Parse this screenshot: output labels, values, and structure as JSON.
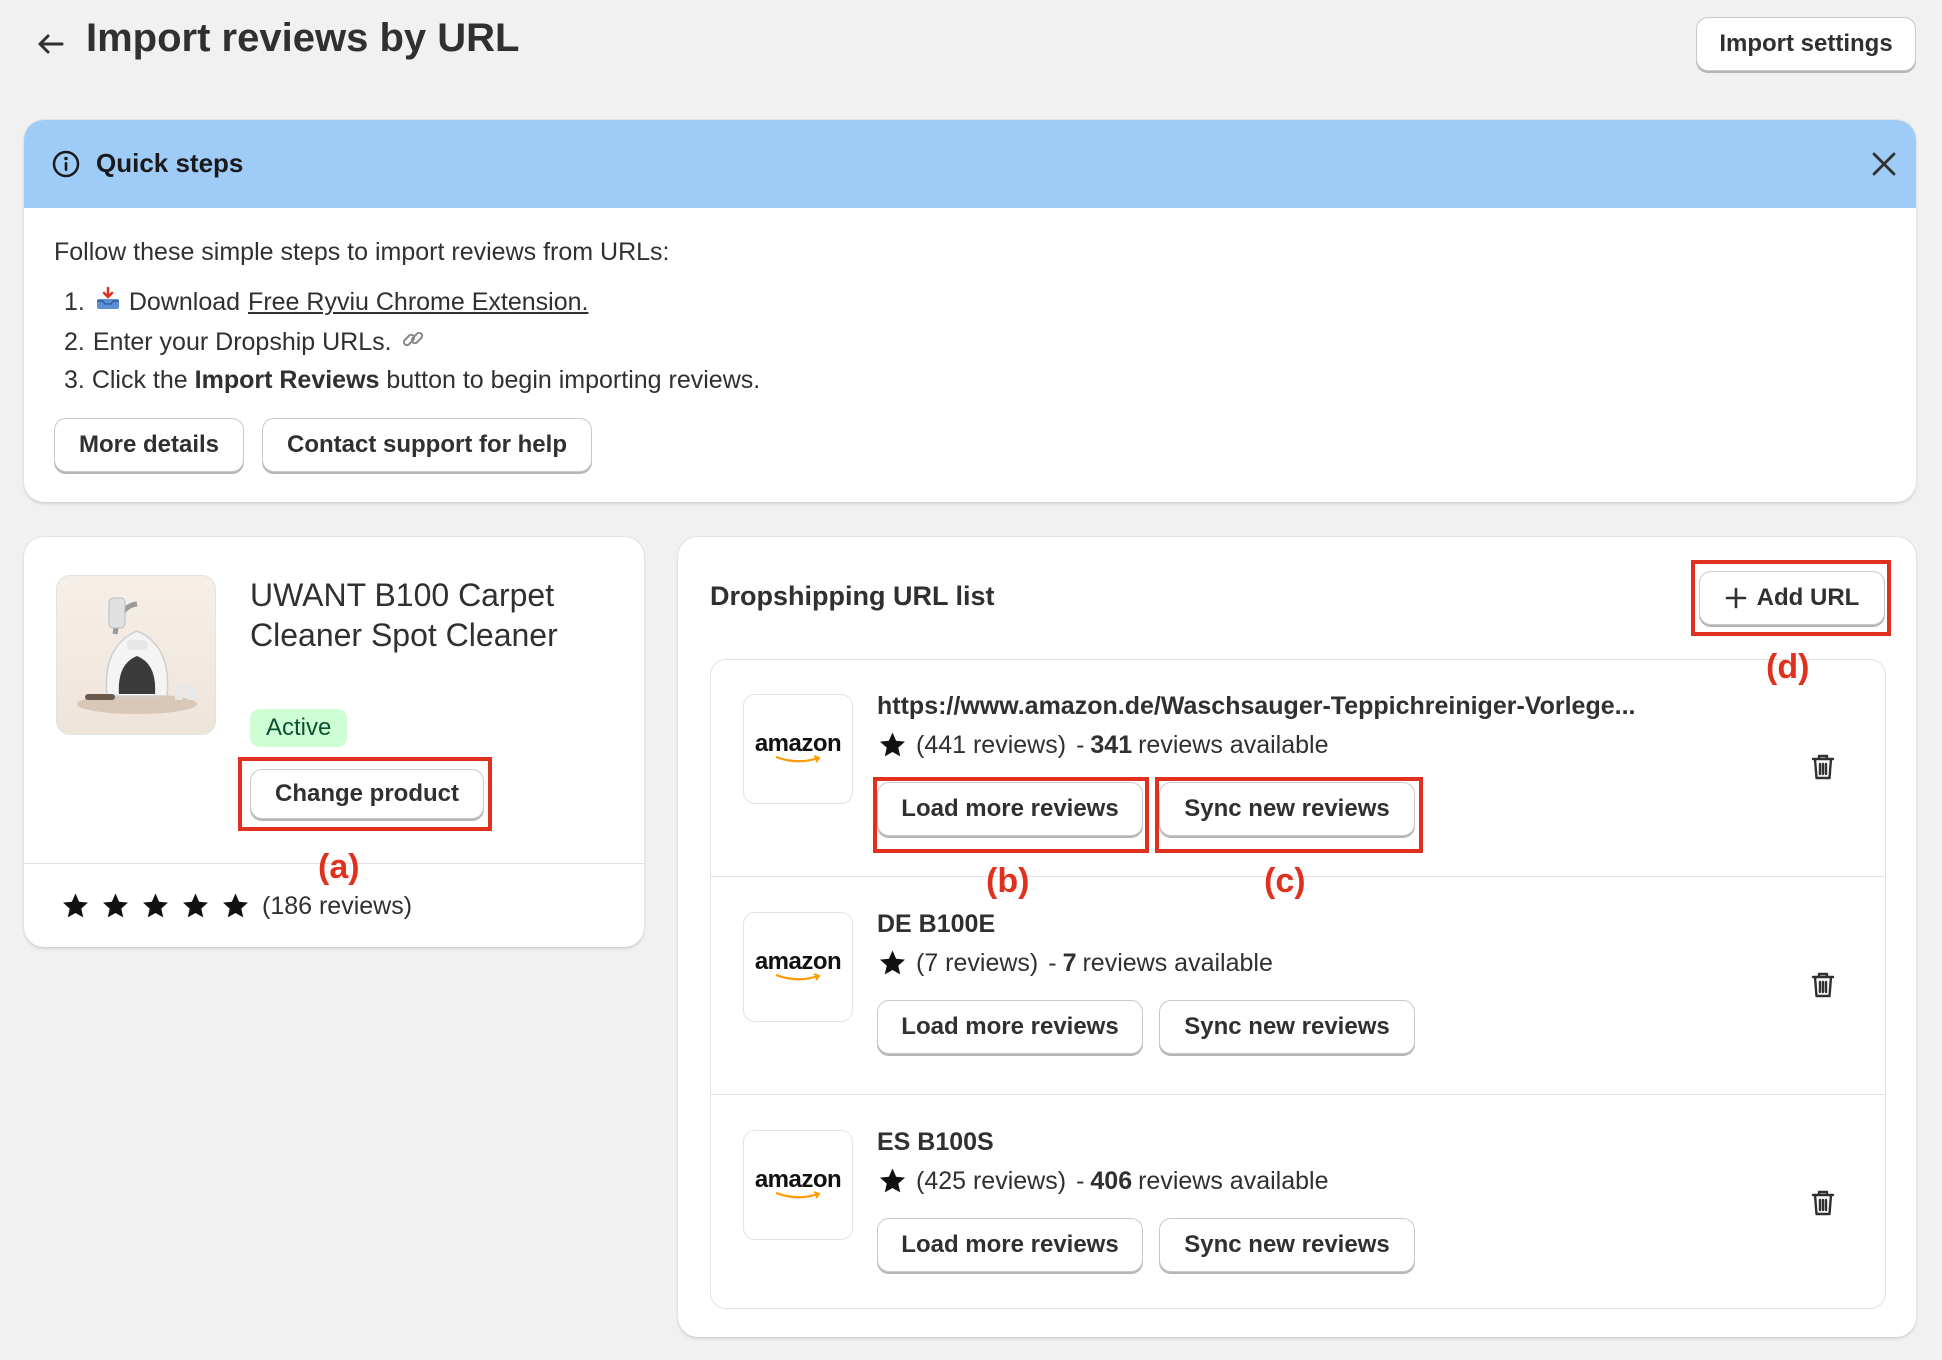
{
  "header": {
    "title": "Import reviews by URL",
    "settings_button": "Import settings"
  },
  "quick_steps": {
    "title": "Quick steps",
    "intro": "Follow these simple steps to import reviews from URLs:",
    "step1_prefix": "1.",
    "step1_text": "Download",
    "step1_link": "Free Ryviu Chrome Extension.",
    "step2_prefix": "2.",
    "step2_text": "Enter your Dropship URLs.",
    "step3_prefix": "3.",
    "step3_pre": "Click the",
    "step3_bold": "Import Reviews",
    "step3_post": "button to begin importing reviews.",
    "more_details": "More details",
    "contact_support": "Contact support for help"
  },
  "product": {
    "name_line1": "UWANT B100 Carpet",
    "name_line2": "Cleaner Spot Cleaner",
    "status": "Active",
    "change_button": "Change product",
    "rating_stars": 5,
    "review_count": "(186 reviews)"
  },
  "url_list": {
    "title": "Dropshipping URL list",
    "add_button": "Add URL",
    "logo_text": "amazon",
    "load_more_label": "Load more reviews",
    "sync_label": "Sync new reviews",
    "items": [
      {
        "name": "https://www.amazon.de/Waschsauger-Teppichreiniger-Vorlege...",
        "reviews": "(441 reviews)",
        "dash": "-",
        "available_count": "341",
        "available_label": "reviews available"
      },
      {
        "name": "DE B100E",
        "reviews": "(7 reviews)",
        "dash": "-",
        "available_count": "7",
        "available_label": "reviews available"
      },
      {
        "name": "ES B100S",
        "reviews": "(425 reviews)",
        "dash": "-",
        "available_count": "406",
        "available_label": "reviews available"
      }
    ]
  },
  "annotations": {
    "a": "(a)",
    "b": "(b)",
    "c": "(c)",
    "d": "(d)"
  },
  "colors": {
    "banner_bg": "#9fcbf7",
    "active_badge_bg": "#cdfed4",
    "annotation_red": "#e0301e"
  }
}
